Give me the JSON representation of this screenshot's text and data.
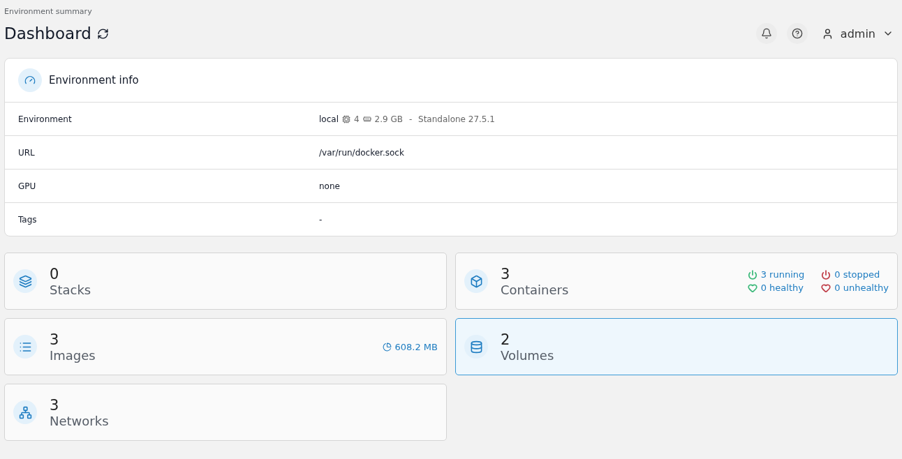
{
  "breadcrumb": "Environment summary",
  "title": "Dashboard",
  "user": {
    "name": "admin"
  },
  "info": {
    "title": "Environment info",
    "rows": [
      {
        "label": "Environment",
        "kind": "env",
        "name": "local",
        "cpu": "4",
        "memory": "2.9 GB",
        "separator": "-",
        "type": "Standalone 27.5.1"
      },
      {
        "label": "URL",
        "kind": "text",
        "value": "/var/run/docker.sock"
      },
      {
        "label": "GPU",
        "kind": "text",
        "value": "none"
      },
      {
        "label": "Tags",
        "kind": "text",
        "value": "-"
      }
    ]
  },
  "cards": [
    {
      "kind": "stacks",
      "count": "0",
      "label": "Stacks",
      "highlighted": false
    },
    {
      "kind": "containers",
      "count": "3",
      "label": "Containers",
      "highlighted": false,
      "status": [
        {
          "kind": "running",
          "text": "3 running",
          "color": "#3cb97a"
        },
        {
          "kind": "stopped",
          "text": "0 stopped",
          "color": "#c0404a"
        },
        {
          "kind": "healthy",
          "text": "0 healthy",
          "color": "#3cb97a"
        },
        {
          "kind": "unhealthy",
          "text": "0 unhealthy",
          "color": "#c0404a"
        }
      ]
    },
    {
      "kind": "images",
      "count": "3",
      "label": "Images",
      "highlighted": false,
      "size": "608.2 MB"
    },
    {
      "kind": "volumes",
      "count": "2",
      "label": "Volumes",
      "highlighted": true
    },
    {
      "kind": "networks",
      "count": "3",
      "label": "Networks",
      "highlighted": false
    }
  ]
}
